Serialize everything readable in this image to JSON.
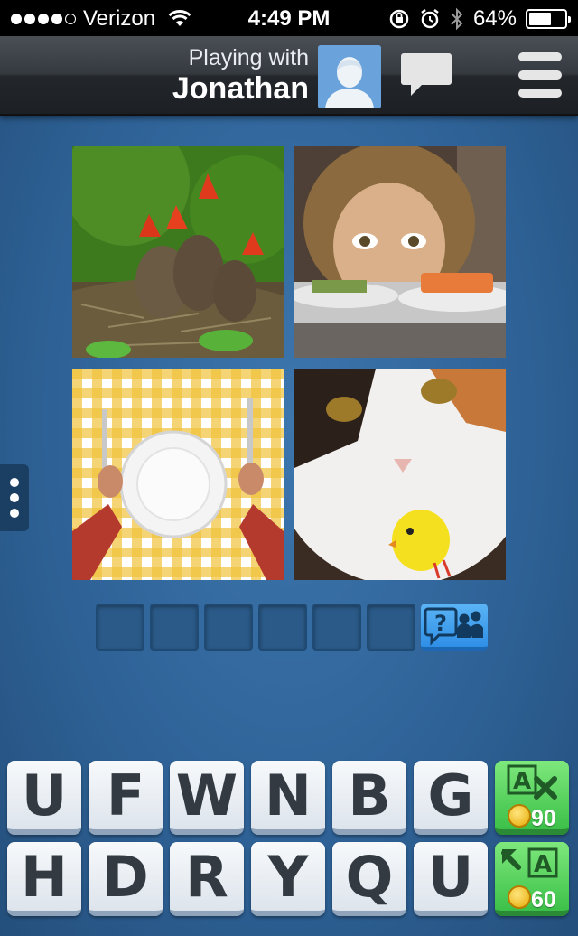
{
  "status_bar": {
    "carrier": "Verizon",
    "time": "4:49 PM",
    "battery": "64%",
    "battery_level": 0.64,
    "signal_bars": 4
  },
  "header": {
    "playing_label": "Playing with",
    "player_name": "Jonathan"
  },
  "puzzle": {
    "images": [
      {
        "name": "baby-birds-in-nest"
      },
      {
        "name": "woman-staring-at-sushi"
      },
      {
        "name": "empty-plate-with-fork-and-knife"
      },
      {
        "name": "cat-looking-at-chick"
      }
    ],
    "answer_slots": [
      "",
      "",
      "",
      "",
      "",
      ""
    ],
    "ask_friends_icon": "question-people-icon"
  },
  "keyboard": {
    "row1": [
      "U",
      "F",
      "W",
      "N",
      "B",
      "G"
    ],
    "row2": [
      "H",
      "D",
      "R",
      "Y",
      "Q",
      "U"
    ]
  },
  "powerups": {
    "remove_letter": {
      "icon": "remove-letter-icon",
      "letter": "A",
      "cost": "90"
    },
    "reveal_letter": {
      "icon": "reveal-letter-icon",
      "letter": "A",
      "cost": "60"
    }
  },
  "colors": {
    "background": "#2f6398",
    "powerup_green": "#3cc049",
    "ask_blue": "#2f8fe6"
  }
}
